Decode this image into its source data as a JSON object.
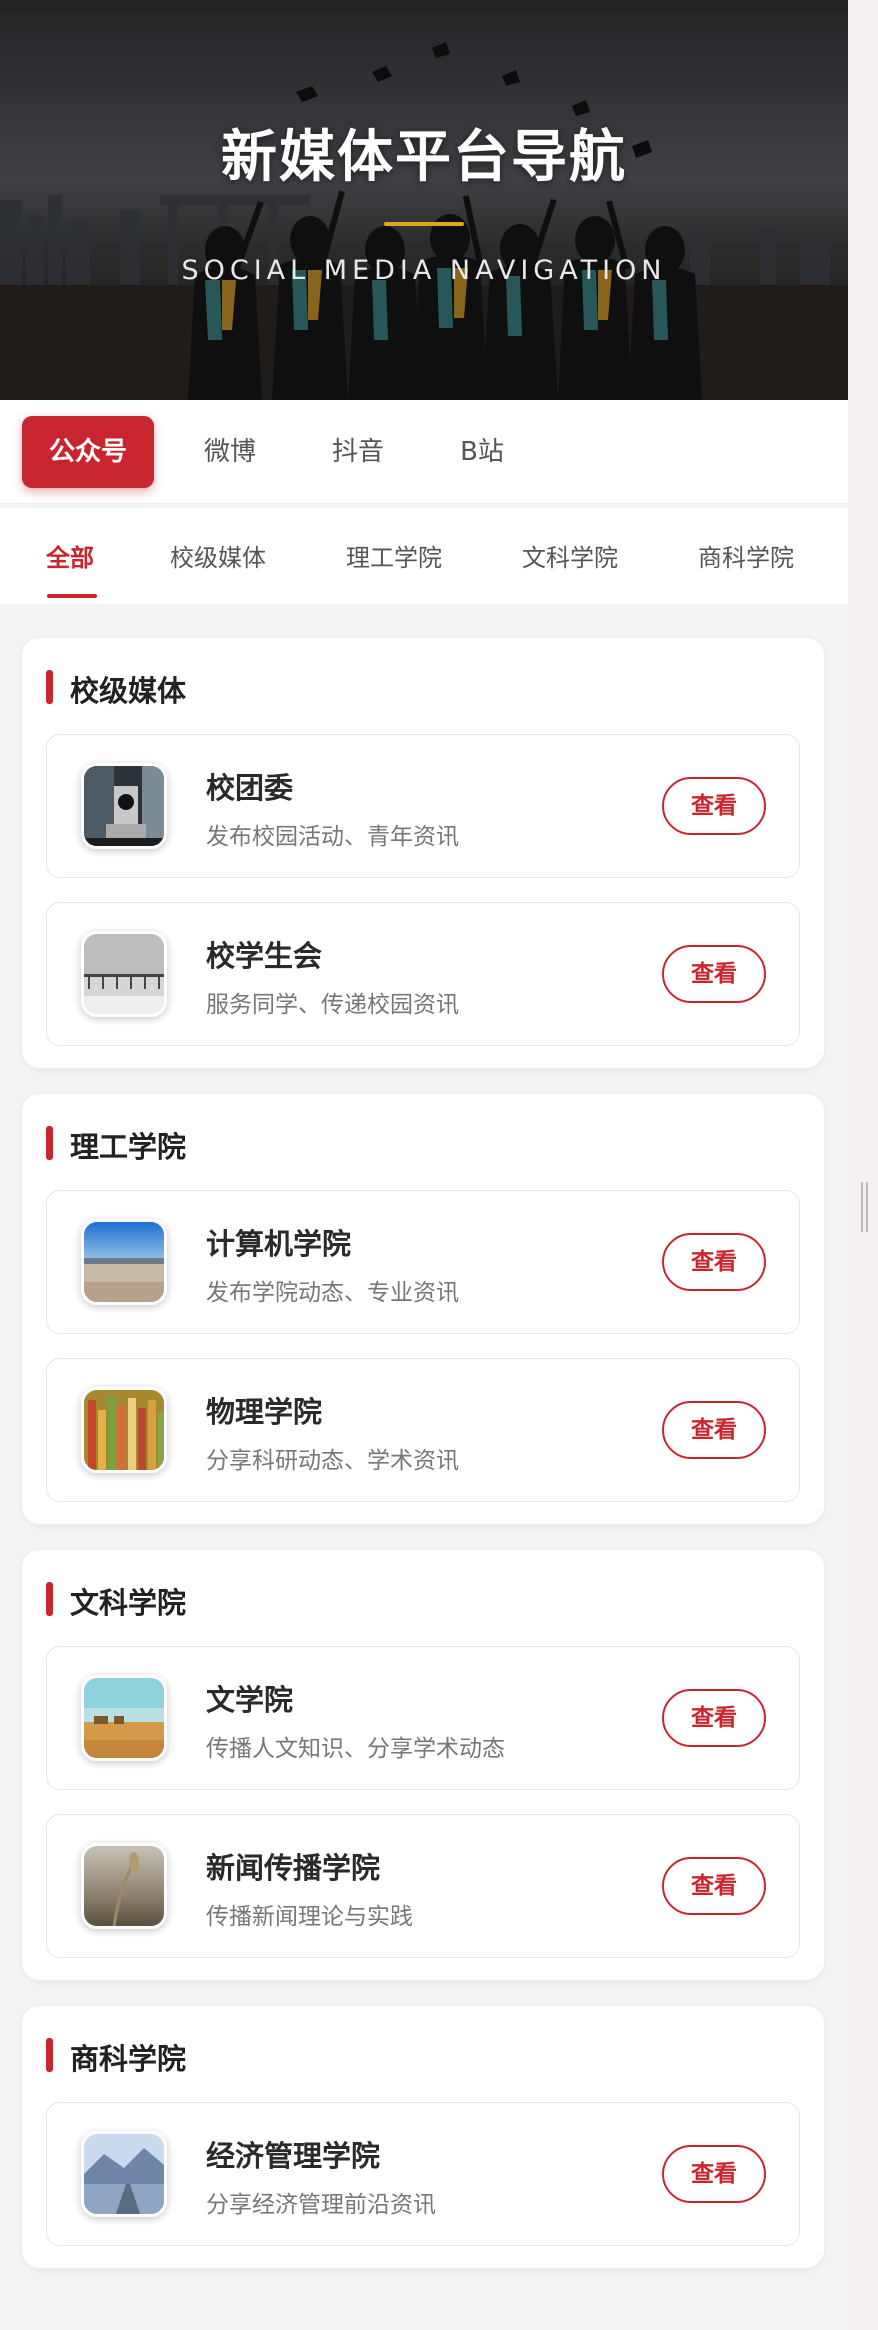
{
  "hero": {
    "title": "新媒体平台导航",
    "subtitle": "SOCIAL MEDIA NAVIGATION",
    "accent_color": "#e6a21c"
  },
  "platform_tabs": [
    {
      "label": "公众号",
      "active": true
    },
    {
      "label": "微博",
      "active": false
    },
    {
      "label": "抖音",
      "active": false
    },
    {
      "label": "B站",
      "active": false
    }
  ],
  "category_tabs": [
    {
      "label": "全部",
      "active": true
    },
    {
      "label": "校级媒体",
      "active": false
    },
    {
      "label": "理工学院",
      "active": false
    },
    {
      "label": "文科学院",
      "active": false
    },
    {
      "label": "商科学院",
      "active": false
    }
  ],
  "sections": [
    {
      "title": "校级媒体",
      "items": [
        {
          "name": "校团委",
          "desc": "发布校园活动、青年资讯",
          "button": "查看",
          "thumb": "microscope-photo"
        },
        {
          "name": "校学生会",
          "desc": "服务同学、传递校园资讯",
          "button": "查看",
          "thumb": "pier-photo"
        }
      ]
    },
    {
      "title": "理工学院",
      "items": [
        {
          "name": "计算机学院",
          "desc": "发布学院动态、专业资讯",
          "button": "查看",
          "thumb": "beach-photo"
        },
        {
          "name": "物理学院",
          "desc": "分享科研动态、学术资讯",
          "button": "查看",
          "thumb": "pencils-photo"
        }
      ]
    },
    {
      "title": "文科学院",
      "items": [
        {
          "name": "文学院",
          "desc": "传播人文知识、分享学术动态",
          "button": "查看",
          "thumb": "field-photo"
        },
        {
          "name": "新闻传播学院",
          "desc": "传播新闻理论与实践",
          "button": "查看",
          "thumb": "wheat-photo"
        }
      ]
    },
    {
      "title": "商科学院",
      "items": [
        {
          "name": "经济管理学院",
          "desc": "分享经济管理前沿资讯",
          "button": "查看",
          "thumb": "boardwalk-photo"
        }
      ]
    }
  ],
  "colors": {
    "brand": "#c9252e",
    "background": "#f4f4f6"
  }
}
